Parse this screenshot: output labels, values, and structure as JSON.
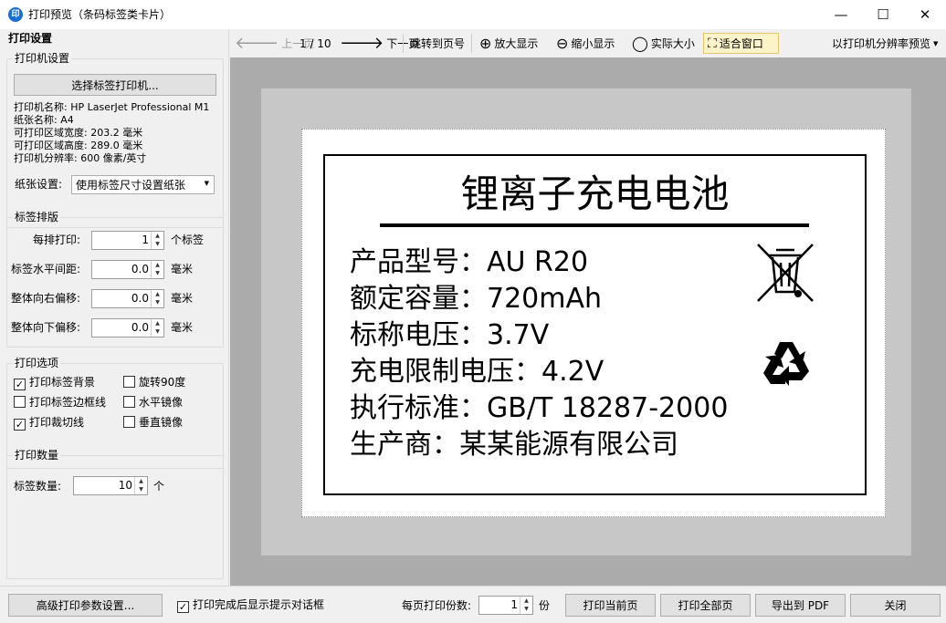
{
  "window": {
    "title": "打印预览（条码标签类卡片）",
    "app_icon_text": "印",
    "minimize": "—",
    "maximize": "☐",
    "close": "✕"
  },
  "settings": {
    "header": "打印设置",
    "printer_group": {
      "title": "打印机设置",
      "select_button": "选择标签打印机...",
      "printer_name": "打印机名称: HP LaserJet Professional M1",
      "paper_name": "纸张名称: A4",
      "printable_width": "可打印区域宽度: 203.2 毫米",
      "printable_height": "可打印区域高度: 289.0 毫米",
      "resolution": "打印机分辨率: 600 像素/英寸",
      "paper_setting_label": "纸张设置:",
      "paper_setting_value": "使用标签尺寸设置纸张"
    },
    "layout_group": {
      "title": "标签排版",
      "per_row_label": "每排打印:",
      "per_row_value": "1",
      "per_row_unit": "个标签",
      "h_spacing_label": "标签水平间距:",
      "h_spacing_value": "0.0",
      "h_spacing_unit": "毫米",
      "offset_right_label": "整体向右偏移:",
      "offset_right_value": "0.0",
      "offset_right_unit": "毫米",
      "offset_down_label": "整体向下偏移:",
      "offset_down_value": "0.0",
      "offset_down_unit": "毫米"
    },
    "options_group": {
      "title": "打印选项",
      "print_background": "打印标签背景",
      "print_background_checked": true,
      "rotate_90": "旋转90度",
      "rotate_90_checked": false,
      "print_border": "打印标签边框线",
      "print_border_checked": false,
      "mirror_h": "水平镜像",
      "mirror_h_checked": false,
      "print_cut_line": "打印裁切线",
      "print_cut_line_checked": true,
      "mirror_v": "垂直镜像",
      "mirror_v_checked": false
    },
    "quantity_group": {
      "title": "打印数量",
      "label": "标签数量:",
      "value": "10",
      "unit": "个"
    }
  },
  "toolbar": {
    "prev_page": "上一页",
    "page_indicator": "1 / 10",
    "next_page": "下一页",
    "goto_page": "跳转到页号",
    "zoom_in": "放大显示",
    "zoom_out": "缩小显示",
    "actual_size": "实际大小",
    "fit_window": "适合窗口",
    "printer_resolution_preview": "以打印机分辨率预览"
  },
  "label": {
    "title": "锂离子充电电池",
    "rows": [
      "产品型号：AU R20",
      "额定容量：720mAh",
      "标称电压：3.7V",
      "充电限制电压：4.2V",
      "执行标准：GB/T 18287-2000",
      "生产商：某某能源有限公司"
    ]
  },
  "bottom": {
    "advanced_button": "高级打印参数设置...",
    "show_dialog_label": "打印完成后显示提示对话框",
    "show_dialog_checked": true,
    "copies_label": "每页打印份数:",
    "copies_value": "1",
    "copies_unit": "份",
    "print_current": "打印当前页",
    "print_all": "打印全部页",
    "export_pdf": "导出到 PDF",
    "close": "关闭"
  }
}
